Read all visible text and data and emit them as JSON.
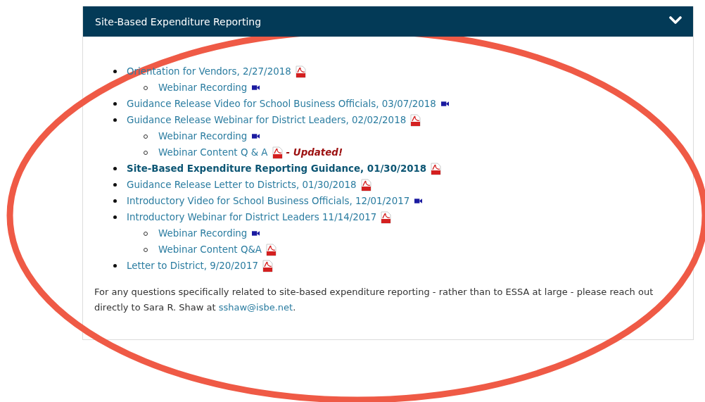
{
  "panel": {
    "title": "Site-Based Expenditure Reporting",
    "expanded": true,
    "items": [
      {
        "label": "Orientation for Vendors, 2/27/2018",
        "kind": "pdf",
        "bold": false,
        "children": [
          {
            "label": "Webinar Recording",
            "kind": "video"
          }
        ]
      },
      {
        "label": "Guidance Release Video for School Business Officials, 03/07/2018",
        "kind": "video",
        "bold": false
      },
      {
        "label": "Guidance Release Webinar for District Leaders, 02/02/2018",
        "kind": "pdf",
        "bold": false,
        "children": [
          {
            "label": "Webinar Recording",
            "kind": "video"
          },
          {
            "label": "Webinar Content Q & A",
            "kind": "pdf",
            "note": "- Updated!"
          }
        ]
      },
      {
        "label": "Site-Based Expenditure Reporting Guidance, 01/30/2018",
        "kind": "pdf",
        "bold": true
      },
      {
        "label": "Guidance Release Letter to Districts, 01/30/2018",
        "kind": "pdf",
        "bold": false
      },
      {
        "label": "Introductory Video for School Business Officials, 12/01/2017",
        "kind": "video",
        "bold": false
      },
      {
        "label": "Introductory Webinar for District Leaders 11/14/2017",
        "kind": "pdf",
        "bold": false,
        "children": [
          {
            "label": "Webinar Recording",
            "kind": "video"
          },
          {
            "label": "Webinar Content Q&A",
            "kind": "pdf"
          }
        ]
      },
      {
        "label": "Letter to District, 9/20/2017",
        "kind": "pdf",
        "bold": false
      }
    ],
    "contact": {
      "text": "For any questions specifically related to site-based expenditure reporting - rather than to ESSA at large - please reach out directly to Sara R. Shaw at",
      "link": "sshaw@isbe.net",
      "after": "."
    }
  }
}
